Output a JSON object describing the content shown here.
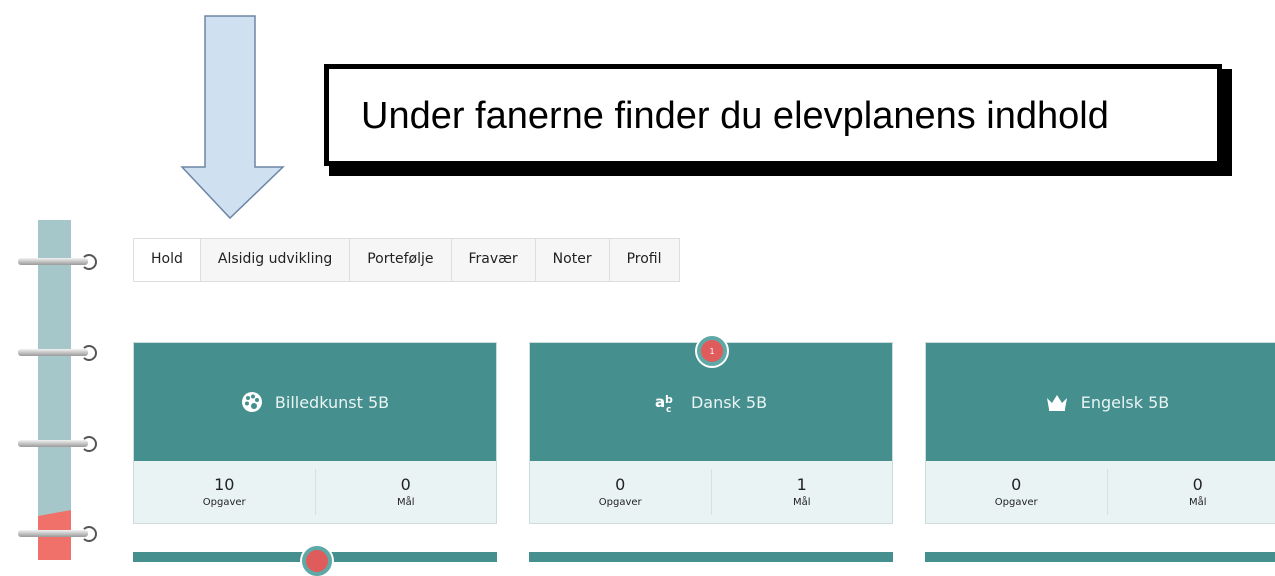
{
  "callout": {
    "text": "Under fanerne finder du elevplanens indhold"
  },
  "tabs": [
    {
      "label": "Hold",
      "active": true
    },
    {
      "label": "Alsidig udvikling",
      "active": false
    },
    {
      "label": "Portefølje",
      "active": false
    },
    {
      "label": "Fravær",
      "active": false
    },
    {
      "label": "Noter",
      "active": false
    },
    {
      "label": "Profil",
      "active": false
    }
  ],
  "cards": [
    {
      "title": "Billedkunst 5B",
      "icon": "palette-icon",
      "opgaver": "10",
      "maal": "0",
      "badge": null
    },
    {
      "title": "Dansk 5B",
      "icon": "abc-letters-icon",
      "opgaver": "0",
      "maal": "1",
      "badge": "1"
    },
    {
      "title": "Engelsk 5B",
      "icon": "crown-icon",
      "opgaver": "0",
      "maal": "0",
      "badge": null
    }
  ],
  "labels": {
    "opgaver": "Opgaver",
    "maal": "Mål"
  },
  "colors": {
    "card_header": "#458f8e",
    "card_stats": "#eaf3f3",
    "badge": "#e05b5b",
    "arrow": "#cfe0f1"
  }
}
